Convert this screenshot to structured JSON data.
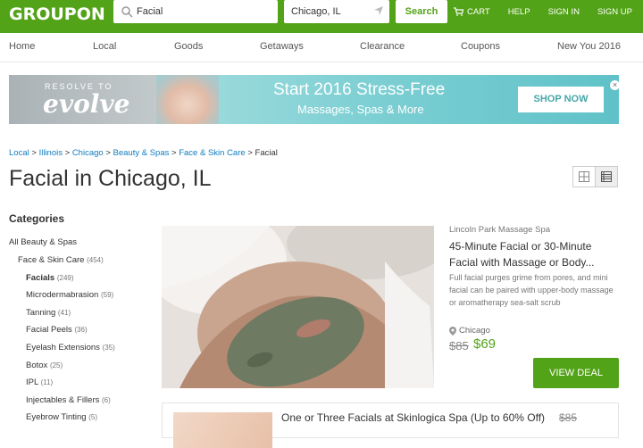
{
  "header": {
    "logo": "GROUPON",
    "search_value": "Facial",
    "location_value": "Chicago, IL",
    "search_button": "Search",
    "cart": "CART",
    "help": "HELP",
    "sign_in": "SIGN IN",
    "sign_up": "SIGN UP"
  },
  "nav": [
    "Home",
    "Local",
    "Goods",
    "Getaways",
    "Clearance",
    "Coupons",
    "New You 2016"
  ],
  "banner": {
    "resolve": "RESOLVE TO",
    "evolve": "evolve",
    "title": "Start 2016 Stress-Free",
    "subtitle": "Massages, Spas & More",
    "button": "SHOP NOW",
    "close": "×"
  },
  "breadcrumb": {
    "items": [
      "Local",
      "Illinois",
      "Chicago",
      "Beauty & Spas",
      "Face & Skin Care"
    ],
    "current": "Facial",
    "sep": ">"
  },
  "page_title": "Facial in Chicago, IL",
  "sidebar": {
    "title": "Categories",
    "items": [
      {
        "label": "All Beauty & Spas",
        "count": ""
      },
      {
        "label": "Face & Skin Care",
        "count": "(454)"
      },
      {
        "label": "Facials",
        "count": "(249)"
      },
      {
        "label": "Microdermabrasion",
        "count": "(59)"
      },
      {
        "label": "Tanning",
        "count": "(41)"
      },
      {
        "label": "Facial Peels",
        "count": "(36)"
      },
      {
        "label": "Eyelash Extensions",
        "count": "(35)"
      },
      {
        "label": "Botox",
        "count": "(25)"
      },
      {
        "label": "IPL",
        "count": "(11)"
      },
      {
        "label": "Injectables & Fillers",
        "count": "(6)"
      },
      {
        "label": "Eyebrow Tinting",
        "count": "(5)"
      }
    ]
  },
  "deal": {
    "merchant": "Lincoln Park Massage Spa",
    "title": "45-Minute Facial or 30-Minute Facial with Massage or Body...",
    "description": "Full facial purges grime from pores, and mini facial can be paired with upper-body massage or aromatherapy sea-salt scrub",
    "location": "Chicago",
    "price_old": "$85",
    "price_new": "$69",
    "button": "VIEW DEAL"
  },
  "deal2": {
    "title": "One or Three Facials at Skinlogica Spa (Up to 60% Off)",
    "price_old": "$85"
  },
  "colors": {
    "brand_green": "#53a318",
    "link_blue": "#0e7cc1",
    "banner_teal": "#5fc2c8"
  }
}
